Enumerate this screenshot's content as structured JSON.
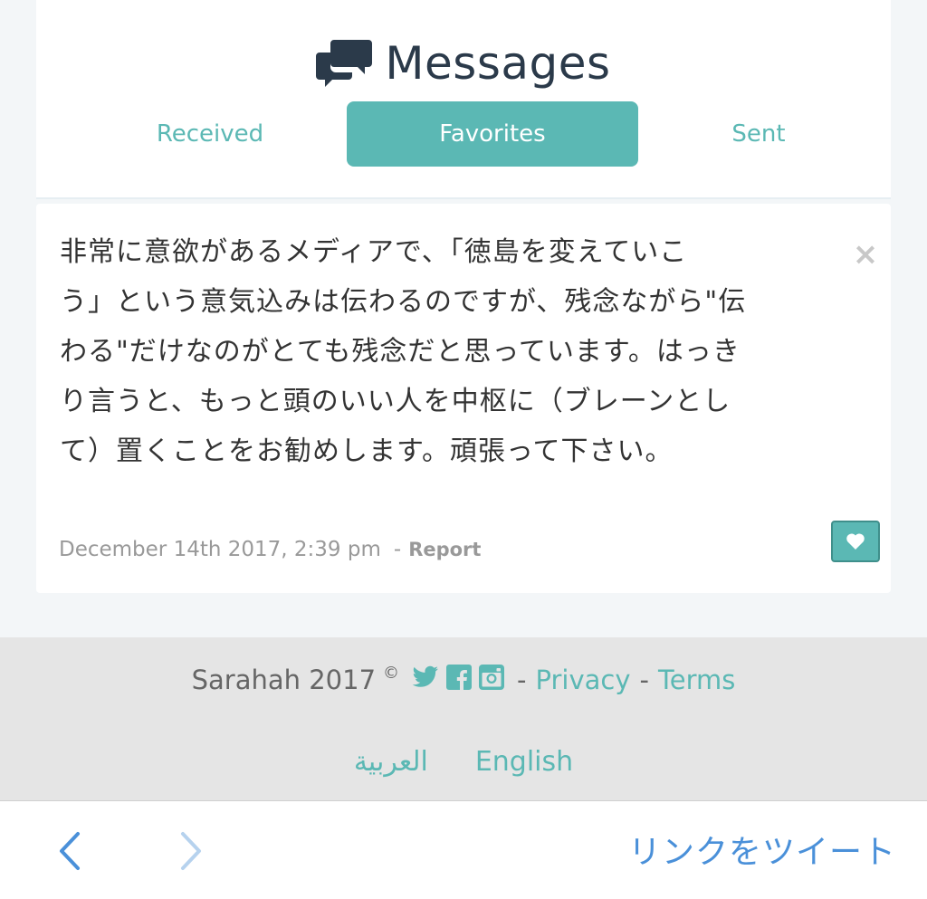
{
  "header": {
    "title": "Messages",
    "title_icon": "chat-bubbles-icon",
    "tabs": [
      {
        "label": "Received",
        "active": false
      },
      {
        "label": "Favorites",
        "active": true
      },
      {
        "label": "Sent",
        "active": false
      }
    ]
  },
  "message": {
    "text": "非常に意欲があるメディアで、「徳島を変えていこう」という意気込みは伝わるのですが、残念ながら\"伝わる\"だけなのがとても残念だと思っています。はっきり言うと、もっと頭のいい人を中枢に（ブレーンとして）置くことをお勧めします。頑張って下さい。",
    "lines": [
      "非常に意欲があるメディアで、「徳島を変えていこ",
      "う」という意気込みは伝わるのですが、残念ながら\"伝",
      "わる\"だけなのがとても残念だと思っています。はっき",
      "り言うと、もっと頭のいい人を中枢に（ブレーンとし",
      "て）置くことをお勧めします。頑張って下さい。"
    ],
    "timestamp": "December 14th 2017, 2:39 pm",
    "separator": "-",
    "report_label": "Report",
    "close_icon": "close-icon",
    "favorite_icon": "heart-icon"
  },
  "footer": {
    "brand": "Sarahah 2017",
    "copyright": "©",
    "social_icons": [
      "twitter-icon",
      "facebook-icon",
      "instagram-icon"
    ],
    "dash": "-",
    "privacy_label": "Privacy",
    "terms_label": "Terms",
    "languages": [
      "العربية",
      "English"
    ]
  },
  "bottom_bar": {
    "back_icon": "chevron-left-icon",
    "forward_icon": "chevron-right-icon",
    "tweet_label": "リンクをツイート"
  },
  "colors": {
    "accent": "#5bb8b4",
    "title": "#2b3a4a",
    "link_blue": "#4a90d9",
    "footer_bg": "#e5e5e5",
    "page_bg": "#f3f6f8"
  }
}
